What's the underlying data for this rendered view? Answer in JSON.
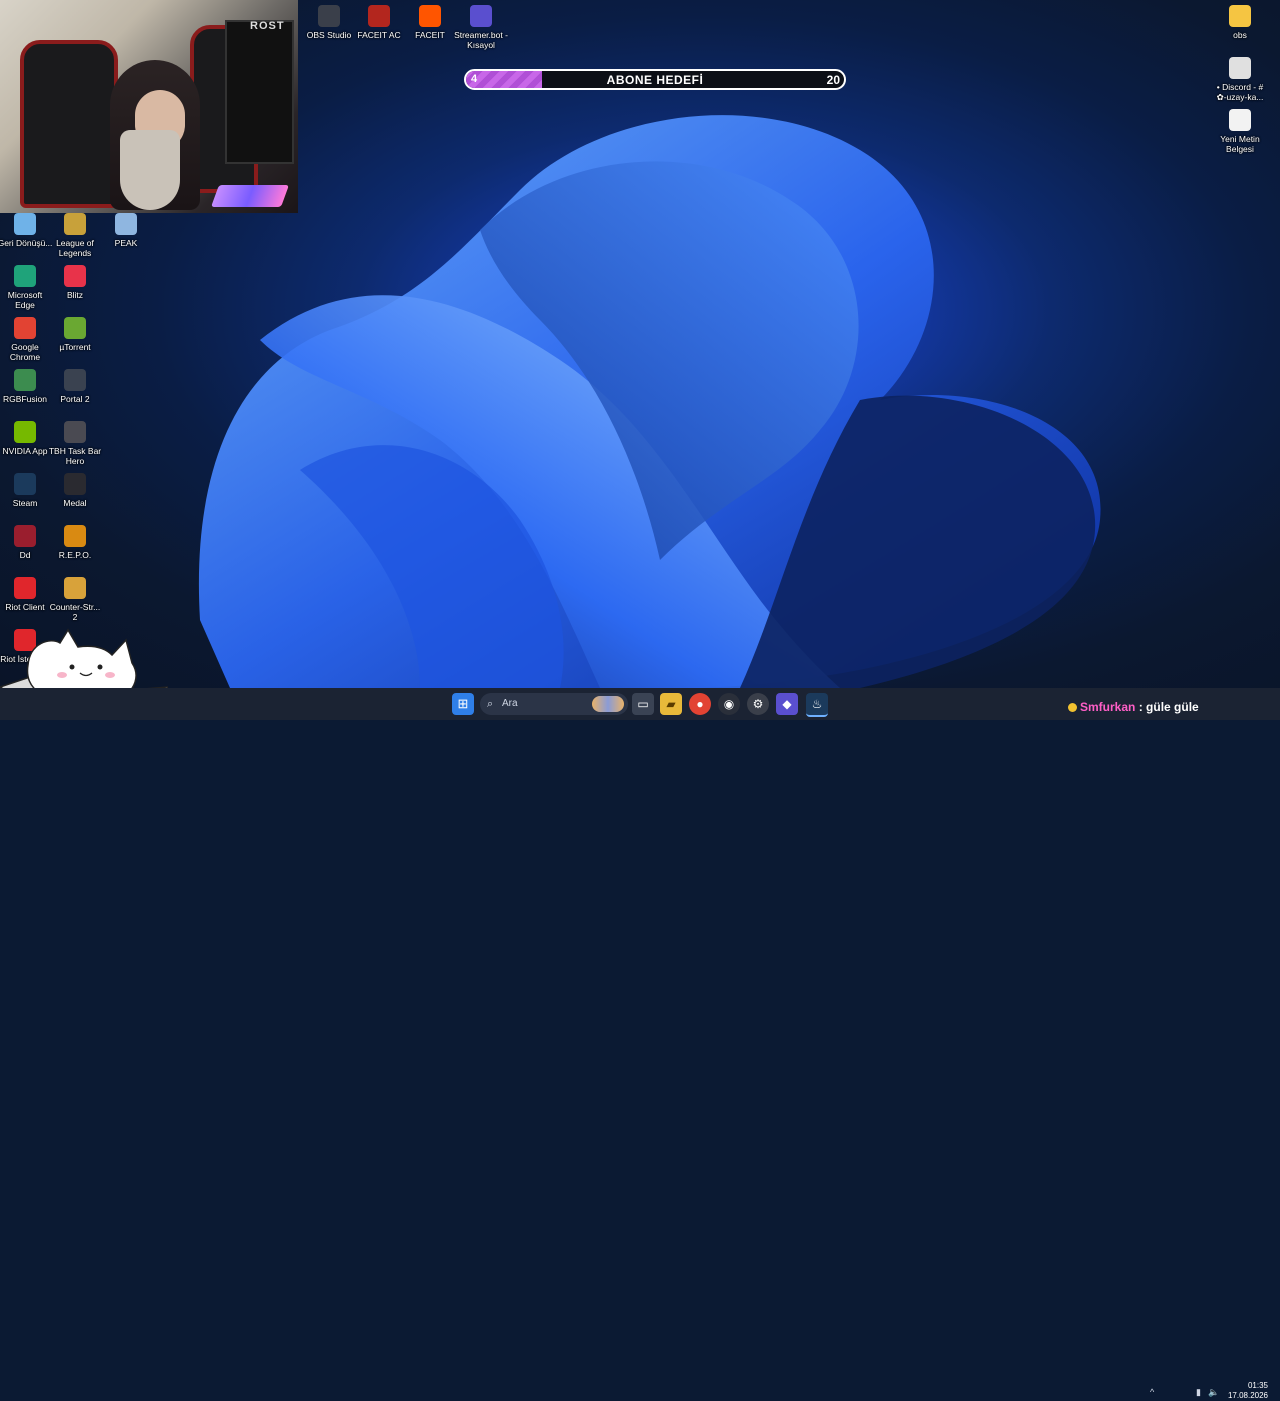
{
  "subscriber_goal": {
    "current": "4",
    "title": "ABONE HEDEFİ",
    "target": "20",
    "progress_fraction": 0.2
  },
  "webcam": {
    "brand_text": "ROST"
  },
  "top_icons": [
    {
      "label": "OBS Studio",
      "icon": "obs-icon",
      "color": "#3a3f4a"
    },
    {
      "label": "FACEIT AC",
      "icon": "faceit-ac-icon",
      "color": "#b3261e"
    },
    {
      "label": "FACEIT",
      "icon": "faceit-icon",
      "color": "#ff5500"
    },
    {
      "label": "Streamer.bot - Kısayol",
      "icon": "streamerbot-icon",
      "color": "#5a4fcf"
    }
  ],
  "right_icons": [
    {
      "label": "obs",
      "icon": "folder-icon",
      "color": "#f5c542"
    },
    {
      "label": "• Discord - # ✿-uzay-ka...",
      "icon": "chrome-shortcut-icon",
      "color": "#e0e0e0"
    },
    {
      "label": "Yeni Metin Belgesi",
      "icon": "text-document-icon",
      "color": "#f2f2f2"
    }
  ],
  "left_col1": [
    {
      "label": "Geri Dönüşü...",
      "icon": "recycle-bin-icon",
      "color": "#6fb2e8"
    },
    {
      "label": "Microsoft Edge",
      "icon": "edge-icon",
      "color": "#1fa37a"
    },
    {
      "label": "Google Chrome",
      "icon": "chrome-icon",
      "color": "#e24333"
    },
    {
      "label": "RGBFusion",
      "icon": "rgbfusion-icon",
      "color": "#3c8c4f"
    },
    {
      "label": "NVIDIA App",
      "icon": "nvidia-icon",
      "color": "#76b900"
    },
    {
      "label": "Steam",
      "icon": "steam-icon",
      "color": "#1b3a5c"
    },
    {
      "label": "Dd",
      "icon": "valorant-icon",
      "color": "#9a1e2e"
    },
    {
      "label": "Riot Client",
      "icon": "riot-client-icon",
      "color": "#e0262c"
    },
    {
      "label": "Riot İstemc...",
      "icon": "riot-client-icon",
      "color": "#e0262c"
    }
  ],
  "left_col2": [
    {
      "label": "League of Legends",
      "icon": "league-icon",
      "color": "#c8a13a"
    },
    {
      "label": "Blitz",
      "icon": "blitz-icon",
      "color": "#e8334a"
    },
    {
      "label": "µTorrent",
      "icon": "utorrent-icon",
      "color": "#6aa832"
    },
    {
      "label": "Portal 2",
      "icon": "portal2-icon",
      "color": "#3a4250"
    },
    {
      "label": "TBH Task Bar Hero",
      "icon": "taskbar-hero-icon",
      "color": "#4a4a52"
    },
    {
      "label": "Medal",
      "icon": "medal-icon",
      "color": "#2a2a30"
    },
    {
      "label": "R.E.P.O.",
      "icon": "repo-icon",
      "color": "#d98a12"
    },
    {
      "label": "Counter-Str... 2",
      "icon": "counter-strike-icon",
      "color": "#d8a23a"
    }
  ],
  "left_col3": [
    {
      "label": "PEAK",
      "icon": "peak-icon",
      "color": "#8fb6e0"
    }
  ],
  "taskbar": {
    "search_placeholder": "Ara",
    "chat_user": "Smfurkan",
    "chat_sep": ":",
    "chat_message": "güle güle",
    "time": "01:35",
    "date": "17.08.2026"
  }
}
